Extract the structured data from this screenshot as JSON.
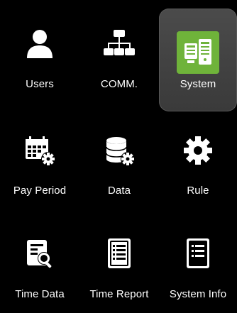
{
  "menu": {
    "items": [
      {
        "label": "Users",
        "icon": "user-icon"
      },
      {
        "label": "COMM.",
        "icon": "network-icon"
      },
      {
        "label": "System",
        "icon": "system-icon",
        "selected": true
      },
      {
        "label": "Pay Period",
        "icon": "calendar-gear-icon"
      },
      {
        "label": "Data",
        "icon": "database-gear-icon"
      },
      {
        "label": "Rule",
        "icon": "gear-icon"
      },
      {
        "label": "Time Data",
        "icon": "document-search-icon"
      },
      {
        "label": "Time Report",
        "icon": "report-icon"
      },
      {
        "label": "System Info",
        "icon": "info-document-icon"
      }
    ]
  },
  "colors": {
    "background": "#000000",
    "selected_tile": "#444444",
    "selected_icon": "#6fb33a",
    "icon": "#ffffff",
    "text": "#ffffff"
  }
}
